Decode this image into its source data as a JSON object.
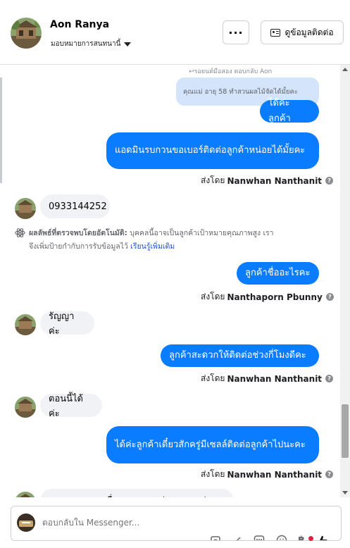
{
  "header": {
    "name": "Aon Ranya",
    "assign_label": "มอบหมายการสนทนานี้",
    "more_label": "···",
    "contact_label": "ดูข้อมูลติดต่อ"
  },
  "thread": {
    "reply_label": "↩รอยนต์มือสอง ตอบกลับ Aon",
    "quoted_text": "คุณแม่ อายุ 58 ทำสวนผลไม้จัดได้มั้ยคะ",
    "m1": "ได้ค่ะลูกค้า",
    "m2": "แอดมินรบกวนขอเบอร์ติดต่อลูกค้าหน่อยได้มั้ยคะ",
    "sent1": {
      "prefix": "ส่งโดย",
      "sender": "Nanwhan Nanthanit"
    },
    "in1": "0933144252",
    "auto_title": "ผลลัพธ์ที่ตรวจพบโดยอัตโนมัติ:",
    "auto_line1": "บุคคลนี้อาจเป็นลูกค้าเป้าหมายคุณภาพสูง เรา",
    "auto_line2": "จึงเพิ่มป้ายกำกับการรับข้อมูลไว้",
    "auto_link": "เรียนรู้เพิ่มเติม",
    "m3": "ลูกค้าชื่ออะไรคะ",
    "sent2": {
      "prefix": "ส่งโดย",
      "sender": "Nanthaporn Pbunny"
    },
    "in2": "รัญญา ค่ะ",
    "m4": "ลูกค้าสะดวกให้ติดต่อช่วงกี่โมงดีคะ",
    "sent3": {
      "prefix": "ส่งโดย",
      "sender": "Nanwhan Nanthanit"
    },
    "in3": "ตอนนี้ได้ค่ะ",
    "m5": "ได้ค่ะลูกค้าเดี๋ยวสักครู่มีเซลล์ติดต่อลูกค้าไปนะคะ",
    "sent4": {
      "prefix": "ส่งโดย",
      "sender": "Nanwhan Nanthanit"
    },
    "in4_partial": "สามารถหลบลงเพื่อแบบจากแหล่งแบบหนาจ่าย"
  },
  "composer": {
    "placeholder": "ตอบกลับใน Messenger..."
  },
  "icons": [
    "gallery-icon",
    "paperclip-icon",
    "chat-bubble-icon",
    "emoji-icon",
    "baht-icon",
    "thumbs-up-icon"
  ]
}
